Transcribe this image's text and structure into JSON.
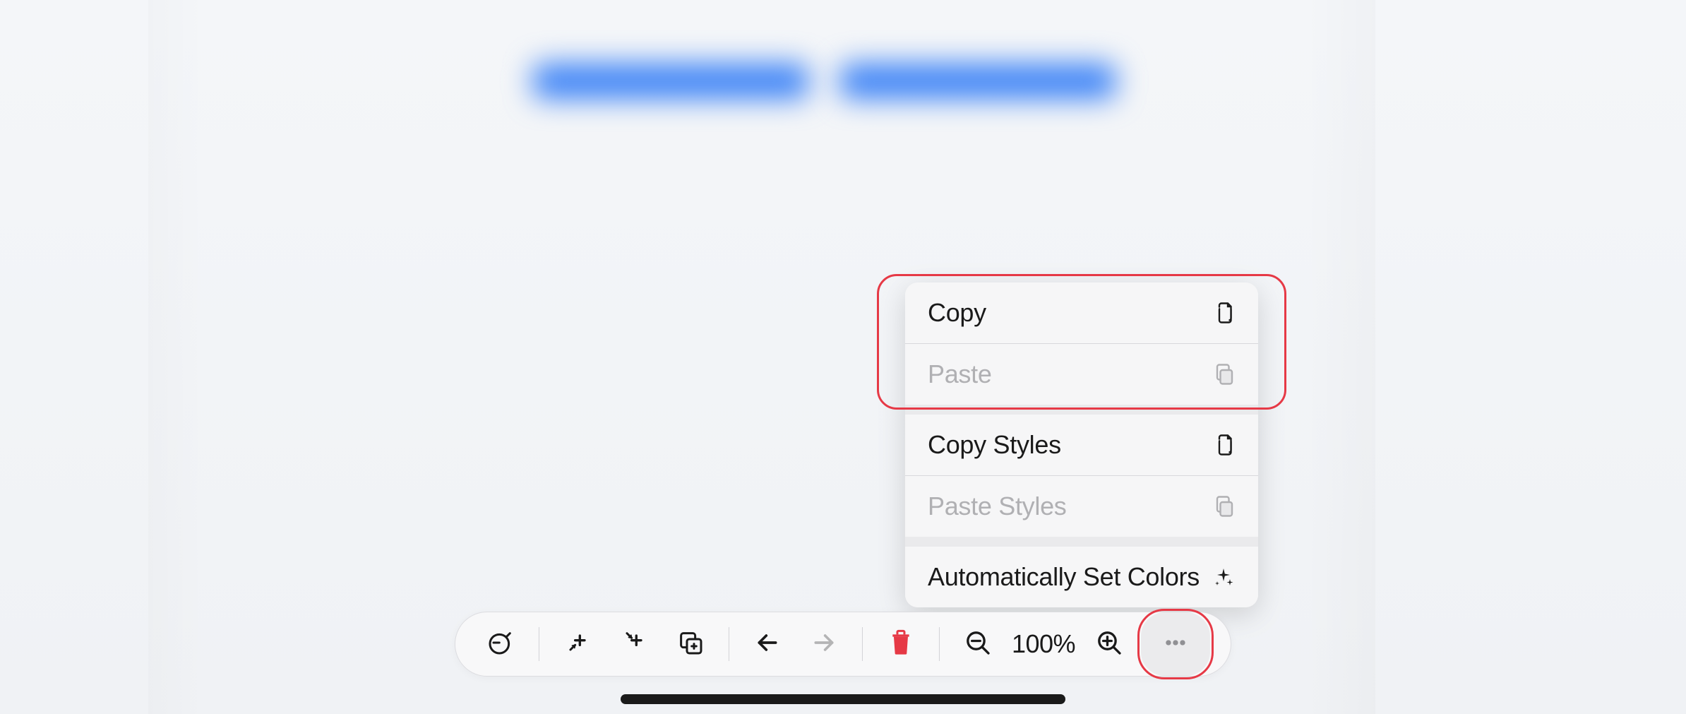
{
  "context_menu": {
    "copy_label": "Copy",
    "paste_label": "Paste",
    "copy_styles_label": "Copy Styles",
    "paste_styles_label": "Paste Styles",
    "auto_colors_label": "Automatically Set Colors"
  },
  "toolbar": {
    "zoom_level": "100%"
  },
  "colors": {
    "highlight": "#e63946",
    "accent_blurred": "#3b82f6",
    "delete": "#e63946"
  }
}
